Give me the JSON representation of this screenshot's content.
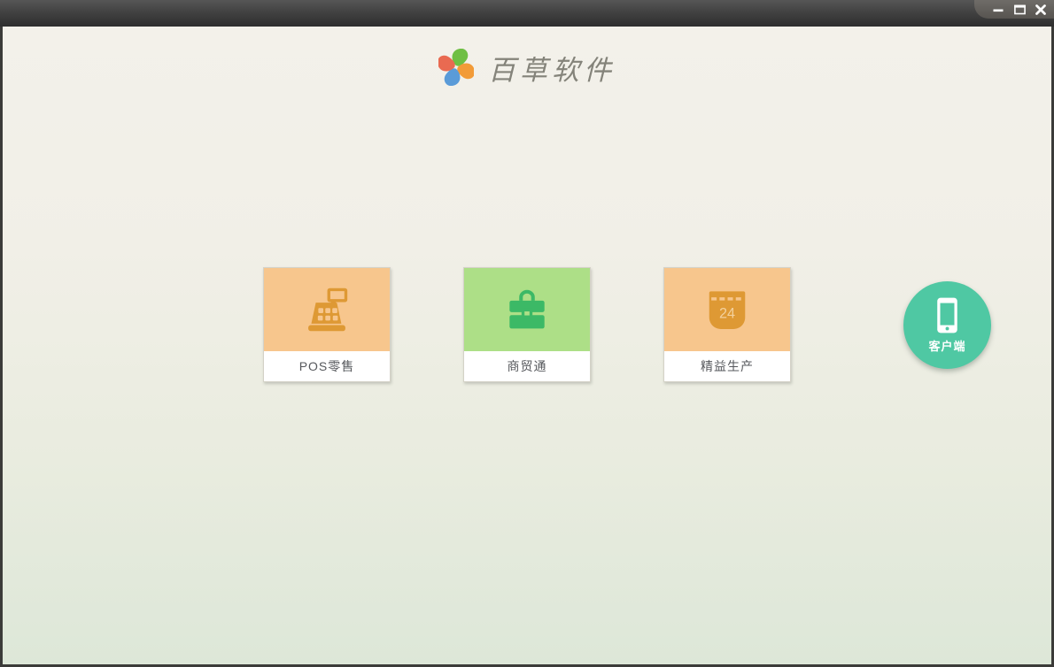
{
  "window": {
    "controls": [
      {
        "name": "minimize",
        "icon": "minimize-icon"
      },
      {
        "name": "maximize",
        "icon": "maximize-icon"
      },
      {
        "name": "close",
        "icon": "close-icon"
      }
    ]
  },
  "header": {
    "app_title": "百草软件",
    "logo": {
      "icon": "pinwheel-logo-icon",
      "petal_colors": [
        "#6fbf44",
        "#f29b38",
        "#5a9bd8",
        "#e96a51"
      ]
    }
  },
  "products": [
    {
      "label": "POS零售",
      "icon": "cash-register-icon",
      "tile_color": "#f7c68d",
      "icon_color": "#de9934"
    },
    {
      "label": "商贸通",
      "icon": "briefcase-icon",
      "tile_color": "#addf87",
      "icon_color": "#3cb966"
    },
    {
      "label": "精益生产",
      "icon": "calendar-icon",
      "calendar_day": "24",
      "tile_color": "#f7c68d",
      "icon_color": "#de9934"
    }
  ],
  "client": {
    "label": "客户端",
    "icon": "smartphone-icon",
    "color": "#4fc8a3"
  },
  "colors": {
    "titlebar_top": "#565656",
    "titlebar_bottom": "#2e2e2e",
    "background_top": "#f3f1ea",
    "background_bottom": "#dde7d8",
    "tile_label_text": "#56585c",
    "brand_title_text": "#84837a",
    "window_border": "#3b3b39"
  }
}
